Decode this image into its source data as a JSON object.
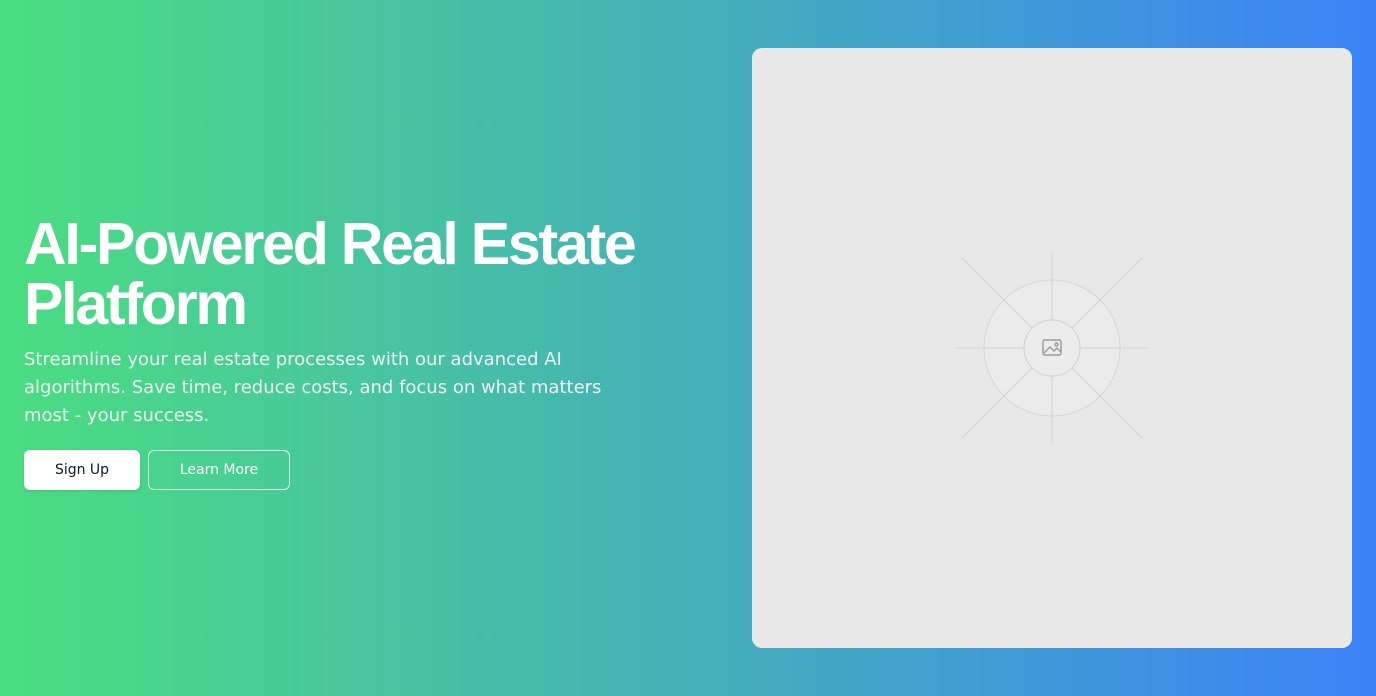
{
  "hero": {
    "title": "AI-Powered Real Estate Platform",
    "subtitle": "Streamline your real estate processes with our advanced AI algorithms. Save time, reduce costs, and focus on what matters most - your success.",
    "primary_button": "Sign Up",
    "secondary_button": "Learn More"
  },
  "image_placeholder": {
    "icon": "image-icon"
  },
  "colors": {
    "gradient_start": "#4ade80",
    "gradient_end": "#3b82f6",
    "card_background": "#e8e8e8",
    "text_light": "#ffffff"
  }
}
